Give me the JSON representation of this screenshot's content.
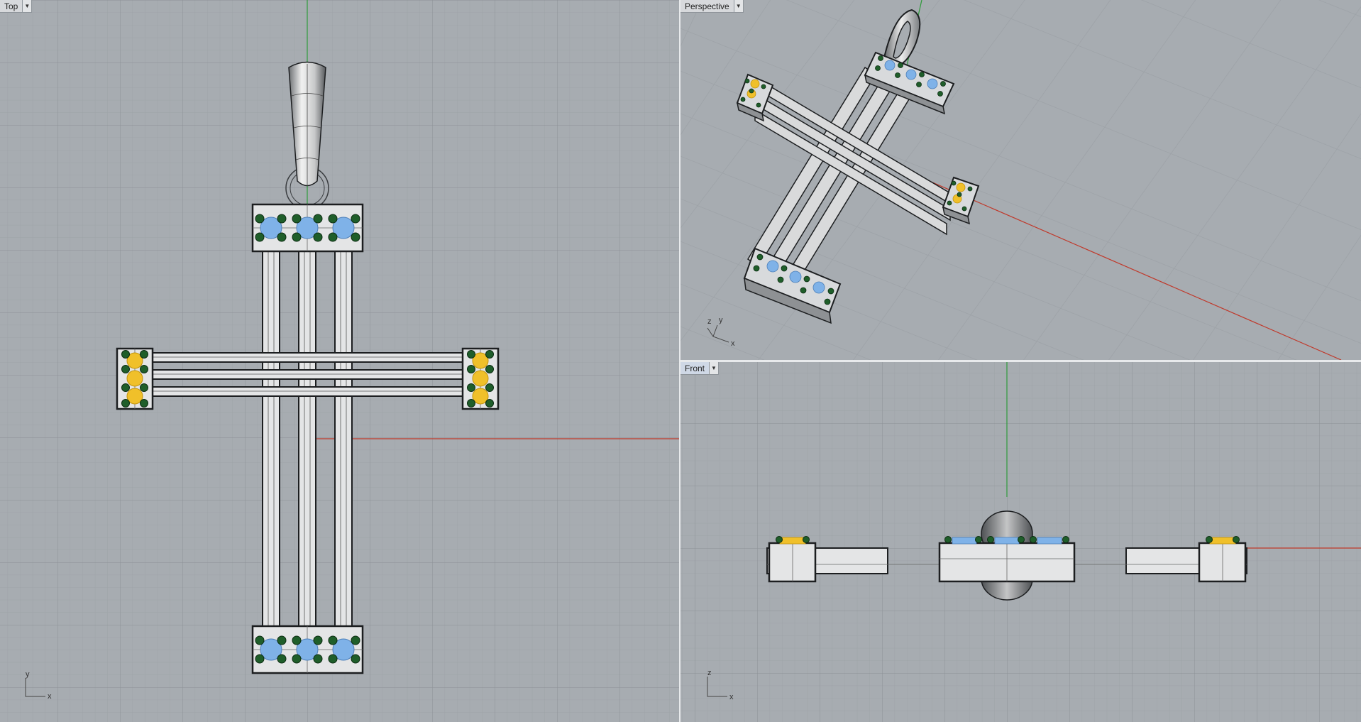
{
  "viewports": {
    "top": {
      "title": "Top",
      "axis_x": "x",
      "axis_y": "y"
    },
    "perspective": {
      "title": "Perspective",
      "axis_x": "x",
      "axis_y": "y",
      "axis_z": "z"
    },
    "front": {
      "title": "Front",
      "axis_x": "x",
      "axis_z": "z"
    }
  },
  "icons": {
    "dropdown": "chevron-down-icon"
  },
  "colors": {
    "viewport_bg": "#a7acb1",
    "grid_minor": "#9ea3a8",
    "grid_major": "#8c9196",
    "x_axis": "#c0392b",
    "y_axis": "#2e9a3a",
    "gem_blue": "#7fb2e8",
    "gem_yellow": "#f0c02a",
    "gem_green": "#1f5e2a",
    "metal": "#e4e5e6"
  }
}
